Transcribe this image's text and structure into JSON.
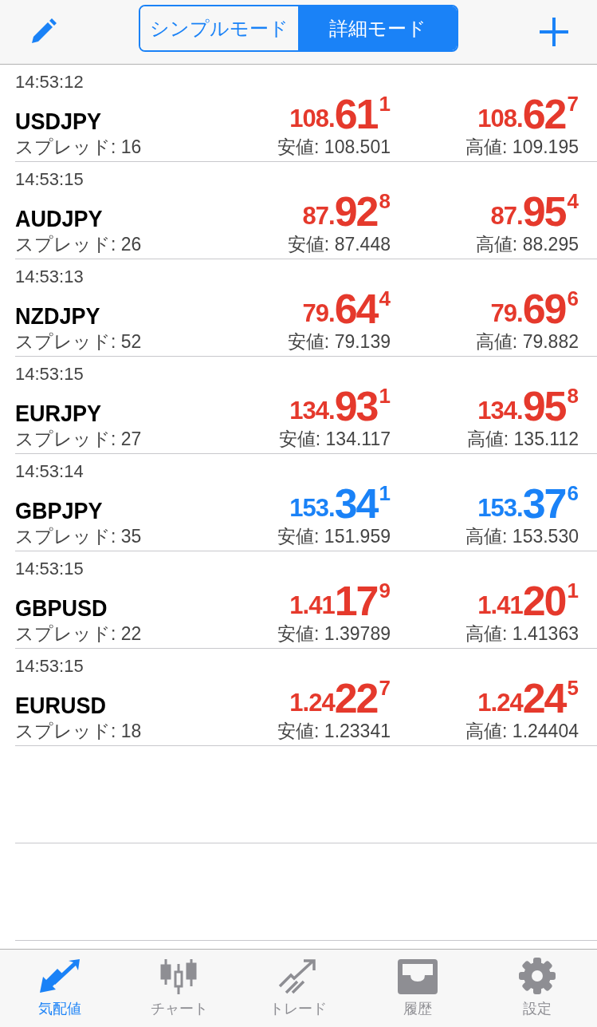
{
  "header": {
    "segments": [
      {
        "label": "シンプルモード",
        "selected": false
      },
      {
        "label": "詳細モード",
        "selected": true
      }
    ]
  },
  "quotes": [
    {
      "time": "14:53:12",
      "symbol": "USDJPY",
      "spread": "スプレッド: 16",
      "color": "#e5392c",
      "bid": {
        "prefix": "108.",
        "big": "61",
        "sup": "1"
      },
      "ask": {
        "prefix": "108.",
        "big": "62",
        "sup": "7"
      },
      "low": "安値: 108.501",
      "high": "高値: 109.195"
    },
    {
      "time": "14:53:15",
      "symbol": "AUDJPY",
      "spread": "スプレッド: 26",
      "color": "#e5392c",
      "bid": {
        "prefix": "87.",
        "big": "92",
        "sup": "8"
      },
      "ask": {
        "prefix": "87.",
        "big": "95",
        "sup": "4"
      },
      "low": "安値: 87.448",
      "high": "高値: 88.295"
    },
    {
      "time": "14:53:13",
      "symbol": "NZDJPY",
      "spread": "スプレッド: 52",
      "color": "#e5392c",
      "bid": {
        "prefix": "79.",
        "big": "64",
        "sup": "4"
      },
      "ask": {
        "prefix": "79.",
        "big": "69",
        "sup": "6"
      },
      "low": "安値: 79.139",
      "high": "高値: 79.882"
    },
    {
      "time": "14:53:15",
      "symbol": "EURJPY",
      "spread": "スプレッド: 27",
      "color": "#e5392c",
      "bid": {
        "prefix": "134.",
        "big": "93",
        "sup": "1"
      },
      "ask": {
        "prefix": "134.",
        "big": "95",
        "sup": "8"
      },
      "low": "安値: 134.117",
      "high": "高値: 135.112"
    },
    {
      "time": "14:53:14",
      "symbol": "GBPJPY",
      "spread": "スプレッド: 35",
      "color": "#1a82f7",
      "bid": {
        "prefix": "153.",
        "big": "34",
        "sup": "1"
      },
      "ask": {
        "prefix": "153.",
        "big": "37",
        "sup": "6"
      },
      "low": "安値: 151.959",
      "high": "高値: 153.530"
    },
    {
      "time": "14:53:15",
      "symbol": "GBPUSD",
      "spread": "スプレッド: 22",
      "color": "#e5392c",
      "bid": {
        "prefix": "1.41",
        "big": "17",
        "sup": "9"
      },
      "ask": {
        "prefix": "1.41",
        "big": "20",
        "sup": "1"
      },
      "low": "安値: 1.39789",
      "high": "高値: 1.41363"
    },
    {
      "time": "14:53:15",
      "symbol": "EURUSD",
      "spread": "スプレッド: 18",
      "color": "#e5392c",
      "bid": {
        "prefix": "1.24",
        "big": "22",
        "sup": "7"
      },
      "ask": {
        "prefix": "1.24",
        "big": "24",
        "sup": "5"
      },
      "low": "安値: 1.23341",
      "high": "高値: 1.24404"
    }
  ],
  "tab_bar": [
    {
      "label": "気配値",
      "kind": "quotes",
      "selected": true
    },
    {
      "label": "チャート",
      "kind": "chart",
      "selected": false
    },
    {
      "label": "トレード",
      "kind": "trade",
      "selected": false
    },
    {
      "label": "履歴",
      "kind": "history",
      "selected": false
    },
    {
      "label": "設定",
      "kind": "settings",
      "selected": false
    }
  ]
}
